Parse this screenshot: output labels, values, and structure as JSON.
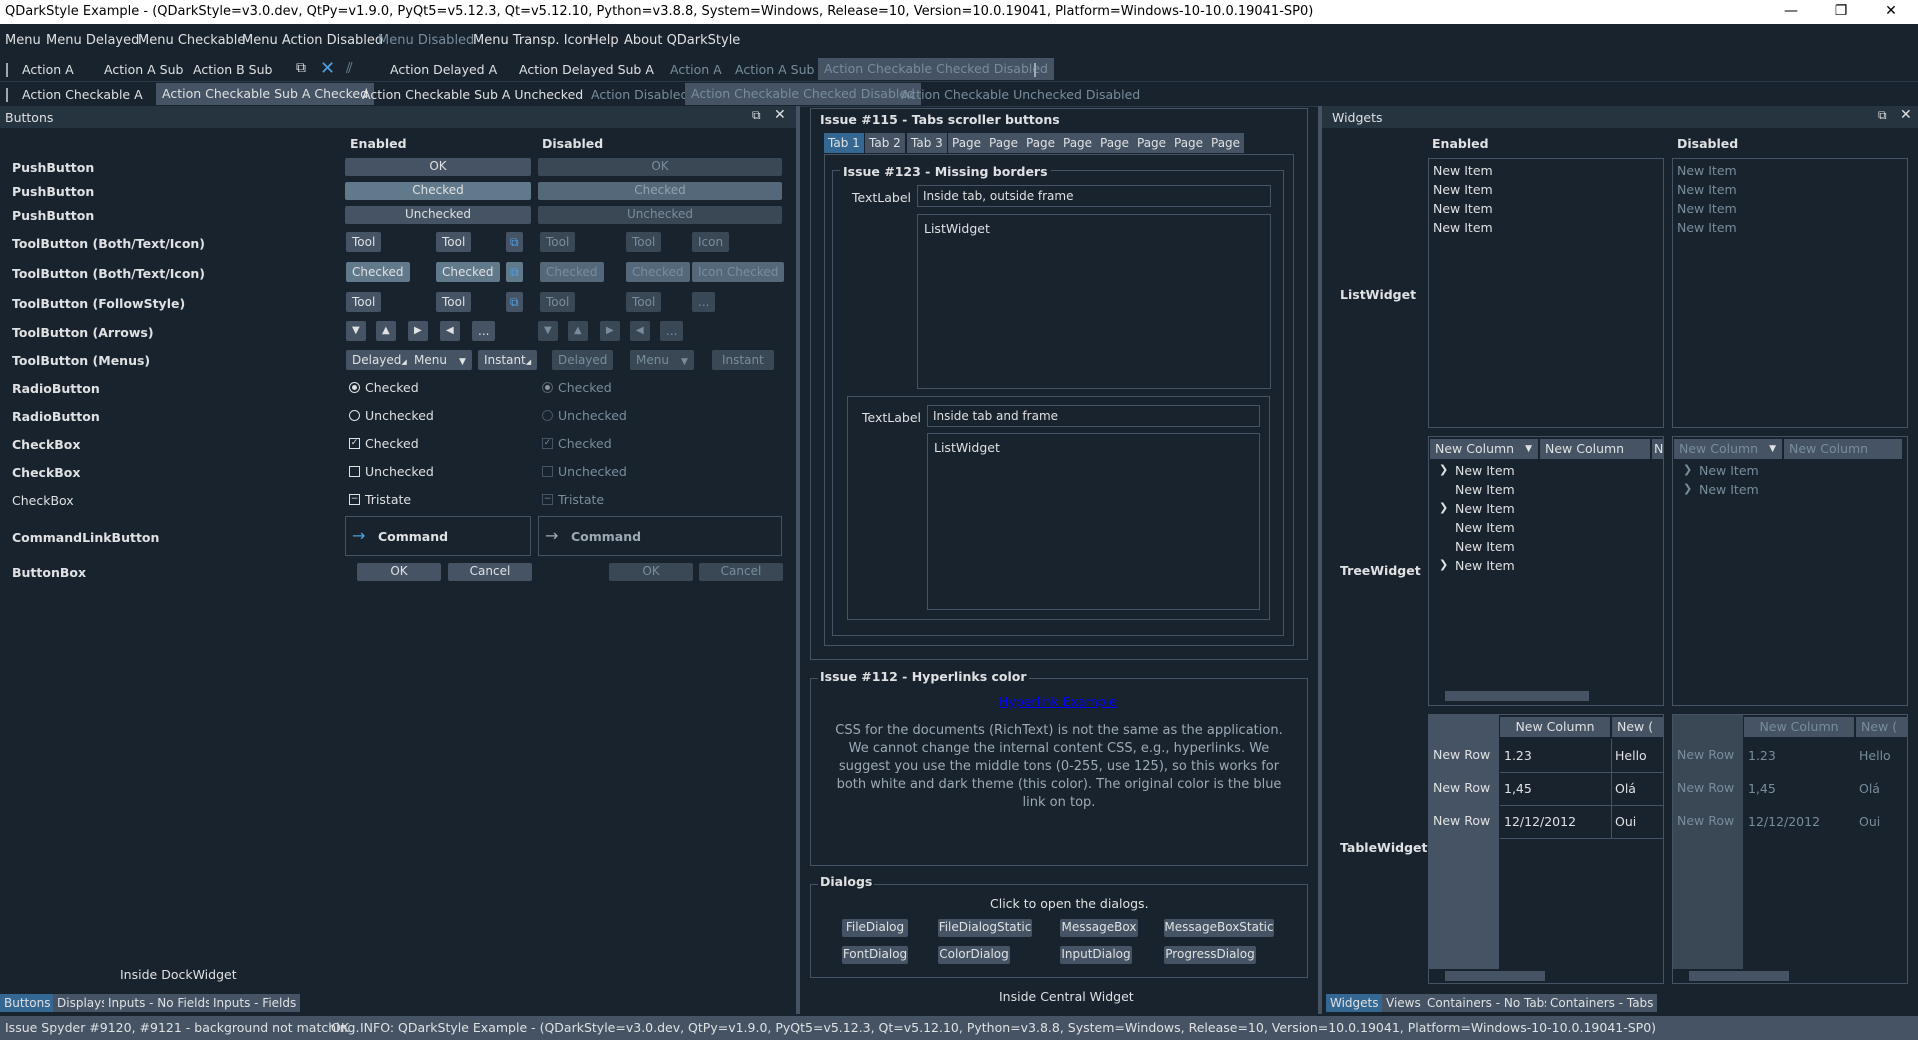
{
  "window": {
    "title": "QDarkStyle Example - (QDarkStyle=v3.0.dev, QtPy=v1.9.0, PyQt5=v5.12.3, Qt=v5.12.10, Python=v3.8.8, System=Windows, Release=10, Version=10.0.19041, Platform=Windows-10-10.0.19041-SP0)",
    "minimize": "—",
    "maximize": "❐",
    "close": "✕"
  },
  "menubar": [
    "Menu",
    "Menu Delayed",
    "Menu Checkable",
    "Menu Action Disabled",
    "Menu Disabled",
    "Menu Transp. Icon",
    "Help",
    "About QDarkStyle"
  ],
  "toolbar1": {
    "items": [
      "Action A",
      "Action A Sub",
      "Action B Sub",
      "Action Delayed A",
      "Action Delayed Sub A",
      "Action A",
      "Action A Sub",
      "Action Checkable Checked Disabled"
    ]
  },
  "toolbar2": {
    "items": [
      "Action Checkable A",
      "Action Checkable Sub A Checked",
      "Action Checkable Sub A Unchecked",
      "Action Disabled",
      "Action Checkable Checked Disabled",
      "Action Checkable Unchecked Disabled"
    ]
  },
  "buttons_dock": {
    "title": "Buttons",
    "col_enabled": "Enabled",
    "col_disabled": "Disabled",
    "rows": [
      "PushButton",
      "PushButton",
      "PushButton",
      "ToolButton (Both/Text/Icon)",
      "ToolButton (Both/Text/Icon)",
      "ToolButton (FollowStyle)",
      "ToolButton (Arrows)",
      "ToolButton (Menus)",
      "RadioButton",
      "RadioButton",
      "CheckBox",
      "CheckBox",
      "CheckBox",
      "CommandLinkButton",
      "ButtonBox"
    ],
    "ok": "OK",
    "checked": "Checked",
    "unchecked": "Unchecked",
    "tool": "Tool",
    "icon": "Icon",
    "icon_checked": "Icon Checked",
    "ellipsis": "...",
    "delayed": "Delayed",
    "menu": "Menu",
    "instant": "Instant",
    "tristate": "Tristate",
    "command": "Command",
    "cancel": "Cancel",
    "inside": "Inside DockWidget",
    "tabs": [
      "Buttons",
      "Displays",
      "Inputs - No Fields",
      "Inputs - Fields"
    ]
  },
  "central": {
    "issue115": "Issue #115 - Tabs scroller buttons",
    "tabs": [
      "Tab 1",
      "Tab 2",
      "Tab 3",
      "Page",
      "Page",
      "Page",
      "Page",
      "Page",
      "Page",
      "Page",
      "Page"
    ],
    "issue123": "Issue #123 - Missing borders",
    "textlabel": "TextLabel",
    "inside_tab_outside": "Inside tab, outside frame",
    "listwidget": "ListWidget",
    "inside_tab_frame": "Inside tab and frame",
    "issue112": "Issue #112 - Hyperlinks color",
    "hyperlink": "Hyperlink Example",
    "css_text": "CSS for the documents (RichText) is not the same as the application. We cannot change the internal content CSS, e.g., hyperlinks. We suggest you use the middle tons (0-255, use 125), so this works for both white and dark theme (this color). The original color is the blue link on top.",
    "dialogs": "Dialogs",
    "click_to_open": "Click to open the dialogs.",
    "dialog_buttons": [
      "FileDialog",
      "FileDialogStatic",
      "MessageBox",
      "MessageBoxStatic",
      "FontDialog",
      "ColorDialog",
      "InputDialog",
      "ProgressDialog"
    ],
    "inside": "Inside Central Widget"
  },
  "widgets_dock": {
    "title": "Widgets",
    "col_enabled": "Enabled",
    "col_disabled": "Disabled",
    "list_label": "ListWidget",
    "tree_label": "TreeWidget",
    "table_label": "TableWidget",
    "new_item": "New Item",
    "new_column": "New Column",
    "new_row": "New Row",
    "new_col_trunc": "New (",
    "n_trunc": "N",
    "table_cells": [
      [
        "1.23",
        "Hello"
      ],
      [
        "1,45",
        "Olá"
      ],
      [
        "12/12/2012",
        "Oui"
      ]
    ],
    "tabs": [
      "Widgets",
      "Views",
      "Containers - No Tabs",
      "Containers - Tabs"
    ]
  },
  "status": {
    "text": "Issue Spyder #9120, #9121 - background not matching.",
    "ok": "OK",
    "info": "INFO: QDarkStyle Example - (QDarkStyle=v3.0.dev, QtPy=v1.9.0, PyQt5=v5.12.3, Qt=v5.12.10, Python=v3.8.8, System=Windows, Release=10, Version=10.0.19041, Platform=Windows-10-10.0.19041-SP0)"
  },
  "colors": {
    "bg": "#19232d",
    "control": "#455364",
    "accent": "#346792",
    "link": "#0000ff"
  }
}
